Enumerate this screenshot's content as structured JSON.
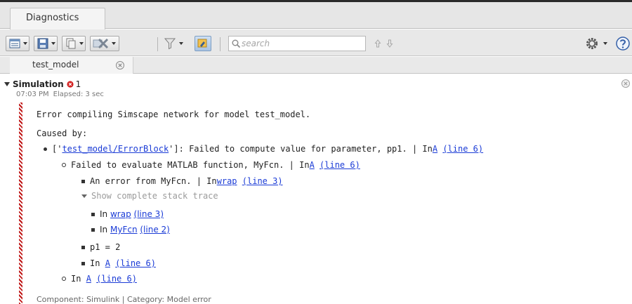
{
  "window": {
    "tab_title": "Diagnostics"
  },
  "toolbar": {
    "search_placeholder": "search"
  },
  "model_tab": {
    "label": "test_model"
  },
  "section": {
    "title": "Simulation",
    "error_count": "1",
    "time": "07:03 PM",
    "elapsed": "Elapsed: 3 sec"
  },
  "messages": {
    "main": "Error compiling Simscape network for model test_model.",
    "caused_by": "Caused by:",
    "l1_prefix": "['",
    "l1_link": "test_model/ErrorBlock",
    "l1_text": "']: Failed to compute value for parameter, pp1. | In ",
    "l1_in_link": "A",
    "l1_line_link": "(line 6)",
    "l2_text": "Failed to evaluate MATLAB function, MyFcn. | In ",
    "l2_in_link": "A",
    "l2_line_link": "(line 6)",
    "l3_text": "An error from MyFcn. | In ",
    "l3_in_link": "wrap",
    "l3_line_link": "(line 3)",
    "stack_toggle": "Show complete stack trace",
    "s1_in": "In",
    "s1_link": "wrap",
    "s1_line": "(line 3)",
    "s2_in": "In",
    "s2_link": "MyFcn",
    "s2_line": "(line 2)",
    "l4_text": "p1 = 2",
    "l5_in": "In",
    "l5_link": "A",
    "l5_line": "(line 6)",
    "l6_in": "In",
    "l6_link": "A",
    "l6_line": "(line 6)"
  },
  "footer": {
    "text": "Component: Simulink | Category: Model error"
  },
  "colors": {
    "link": "#1a3bd6",
    "error": "#c01818"
  }
}
